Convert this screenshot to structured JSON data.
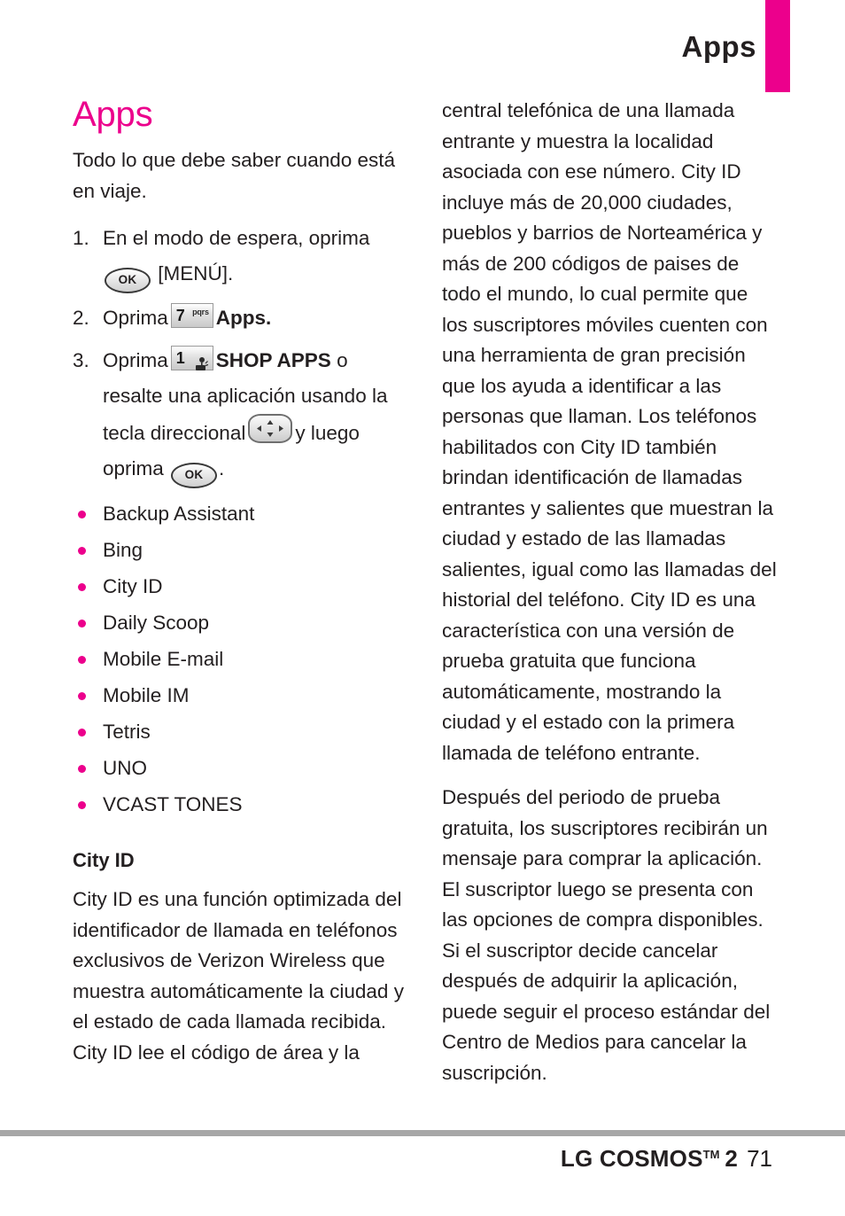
{
  "header": {
    "running_title": "Apps",
    "tab_color": "#ec008c"
  },
  "left_column": {
    "section_title": "Apps",
    "intro": "Todo lo que debe saber cuando está en viaje.",
    "steps": [
      {
        "number": "1.",
        "text_before": "En el modo de espera, oprima",
        "key": "ok-key",
        "key_label": "OK",
        "text_after": "[MENÚ]."
      },
      {
        "number": "2.",
        "text_before": "Oprima",
        "key": "number-key-7",
        "key_digit": "7",
        "key_sub": "pqrs",
        "text_after": "Apps.",
        "text_after_bold": true
      },
      {
        "number": "3.",
        "text_before": "Oprima",
        "key": "number-key-1",
        "key_digit": "1",
        "key_sub": "voicemail-icon",
        "text_after": "SHOP APPS",
        "text_after_bold": true,
        "continuation_1": "o resalte una aplicación usando la tecla direccional",
        "key_2": "navigation-key",
        "continuation_2": "y luego oprima",
        "key_3": "ok-key",
        "key_3_label": "OK",
        "continuation_3": "."
      }
    ],
    "app_list": [
      "Backup Assistant",
      "Bing",
      "City ID",
      "Daily Scoop",
      "Mobile E-mail",
      "Mobile IM",
      "Tetris",
      "UNO",
      "VCAST TONES"
    ],
    "subsection_title": "City ID",
    "subsection_paragraph": "City ID es una función optimizada del identificador de llamada en teléfonos exclusivos de Verizon Wireless que muestra automáticamente la ciudad y el estado de cada llamada recibida. City ID lee el código de área y la"
  },
  "right_column": {
    "paragraph_1": "central telefónica de una llamada entrante y muestra la localidad asociada con ese número. City ID incluye más de 20,000 ciudades, pueblos y barrios de Norteamérica y más de 200 códigos de paises de todo el mundo, lo cual permite que los suscriptores móviles cuenten con una herramienta de gran precisión que los ayuda a identificar a las personas que llaman. Los teléfonos habilitados con City ID también brindan identificación de llamadas entrantes y salientes que muestran la ciudad y estado de las llamadas salientes, igual como las llamadas del historial del teléfono. City ID es una característica con una versión de prueba gratuita que funciona automáticamente, mostrando la ciudad y el estado con la primera llamada de teléfono entrante.",
    "paragraph_2": "Después del periodo de prueba gratuita, los suscriptores recibirán un mensaje para comprar la aplicación. El suscriptor luego se presenta con las opciones de compra disponibles.  Si el suscriptor decide cancelar después de adquirir la aplicación, puede seguir el proceso estándar del Centro de Medios para cancelar la suscripción."
  },
  "footer": {
    "brand": "LG COSMOS",
    "trademark": "TM",
    "model": "2",
    "page_number": "71"
  },
  "colors": {
    "accent_magenta": "#ec008c",
    "text": "#231f20",
    "rule_gray": "#a7a7a7"
  }
}
